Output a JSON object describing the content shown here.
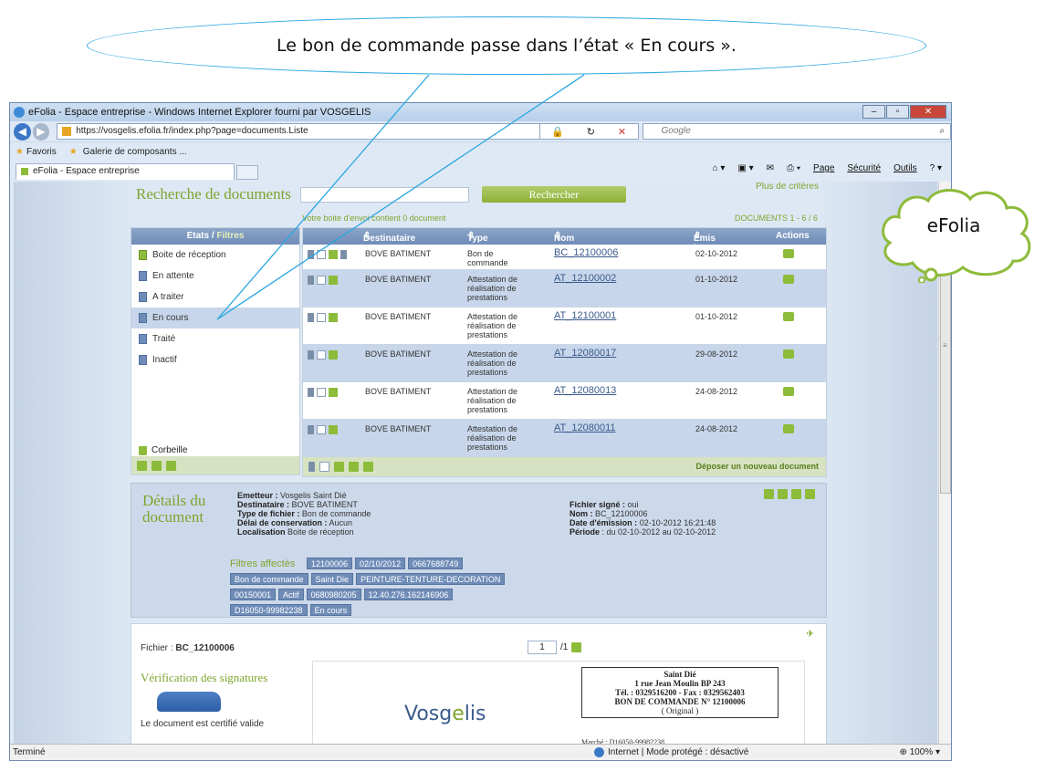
{
  "callout": {
    "text": "Le bon de commande passe dans l’état « En cours »."
  },
  "cloud": {
    "label": "eFolia"
  },
  "browser": {
    "title": "eFolia - Espace entreprise - Windows Internet Explorer fourni par VOSGELIS",
    "url": "https://vosgelis.efolia.fr/index.php?page=documents.Liste",
    "search_placeholder": "Google",
    "favorites_label": "Favoris",
    "gallery_label": "Galerie de composants ...",
    "tab_label": "eFolia - Espace entreprise",
    "cmd": {
      "page": "Page",
      "securite": "Sécurité",
      "outils": "Outils"
    },
    "status": {
      "left": "Terminé",
      "zone": "Internet | Mode protégé : désactivé",
      "zoom": "100%"
    }
  },
  "search": {
    "title": "Recherche de documents",
    "button": "Rechercher",
    "more": "Plus de critères"
  },
  "sidebar": {
    "header_a": "Etats / ",
    "header_b": "Filtres",
    "items": [
      "Boite de réception",
      "En attente",
      "A traiter",
      "En cours",
      "Traité",
      "Inactif"
    ],
    "trash": "Corbeille"
  },
  "list": {
    "inbox_msg": "Votre boite d'envoi contient 0 document",
    "count": "DOCUMENTS 1 - 6 / 6",
    "headers": {
      "dest": "Destinataire",
      "type": "Type",
      "nom": "Nom",
      "emis": "Emis le",
      "actions": "Actions"
    },
    "rows": [
      {
        "dest": "BOVE BATIMENT",
        "type": "Bon de commande",
        "nom": "BC_12100006",
        "date": "02-10-2012"
      },
      {
        "dest": "BOVE BATIMENT",
        "type": "Attestation de réalisation de prestations",
        "nom": "AT_12100002",
        "date": "01-10-2012"
      },
      {
        "dest": "BOVE BATIMENT",
        "type": "Attestation de réalisation de prestations",
        "nom": "AT_12100001",
        "date": "01-10-2012"
      },
      {
        "dest": "BOVE BATIMENT",
        "type": "Attestation de réalisation de prestations",
        "nom": "AT_12080017",
        "date": "29-08-2012"
      },
      {
        "dest": "BOVE BATIMENT",
        "type": "Attestation de réalisation de prestations",
        "nom": "AT_12080013",
        "date": "24-08-2012"
      },
      {
        "dest": "BOVE BATIMENT",
        "type": "Attestation de réalisation de prestations",
        "nom": "AT_12080011",
        "date": "24-08-2012"
      }
    ],
    "deposit": "Déposer un nouveau document"
  },
  "details": {
    "title": "Détails du document",
    "emetteur_k": "Emetteur :",
    "emetteur_v": "Vosgelis Saint Dié",
    "destinataire_k": "Destinataire :",
    "destinataire_v": "BOVE BATIMENT",
    "type_k": "Type de fichier :",
    "type_v": "Bon de commande",
    "delai_k": "Délai de conservation :",
    "delai_v": "Aucun",
    "loc_k": "Localisation",
    "loc_v": "Boite de réception",
    "signe_k": "Fichier signé :",
    "signe_v": "oui",
    "nom_k": "Nom :",
    "nom_v": "BC_12100006",
    "date_k": "Date d'émission :",
    "date_v": "02-10-2012 16:21:48",
    "periode_k": "Période",
    "periode_v": ": du 02-10-2012 au 02-10-2012",
    "filters_label": "Filtres affectés",
    "chips": [
      "12100006",
      "02/10/2012",
      "0667688749",
      "Bon de commande",
      "Saint Die",
      "PEINTURE-TENTURE-DECORATION",
      "00150001",
      "Actif",
      "0680980205",
      "12.40.276.162146906",
      "D16050-99982238",
      "En cours"
    ]
  },
  "preview": {
    "file_k": "Fichier :",
    "file_v": "BC_12100006",
    "page": "1",
    "of": "/1",
    "verif": "Vérification des signatures",
    "cert": "Le document est certifié valide",
    "logo_a": "Vos",
    "logo_b": "g",
    "logo_c": "e",
    "logo_d": "lis",
    "addr": [
      "Saint Dié",
      "1 rue Jean Moulin BP 243",
      "Tél. : 0329516200 - Fax : 0329562403",
      "BON DE COMMANDE N° 12100006",
      "( Original )"
    ],
    "marche": "Marché : D16050-99982238"
  }
}
